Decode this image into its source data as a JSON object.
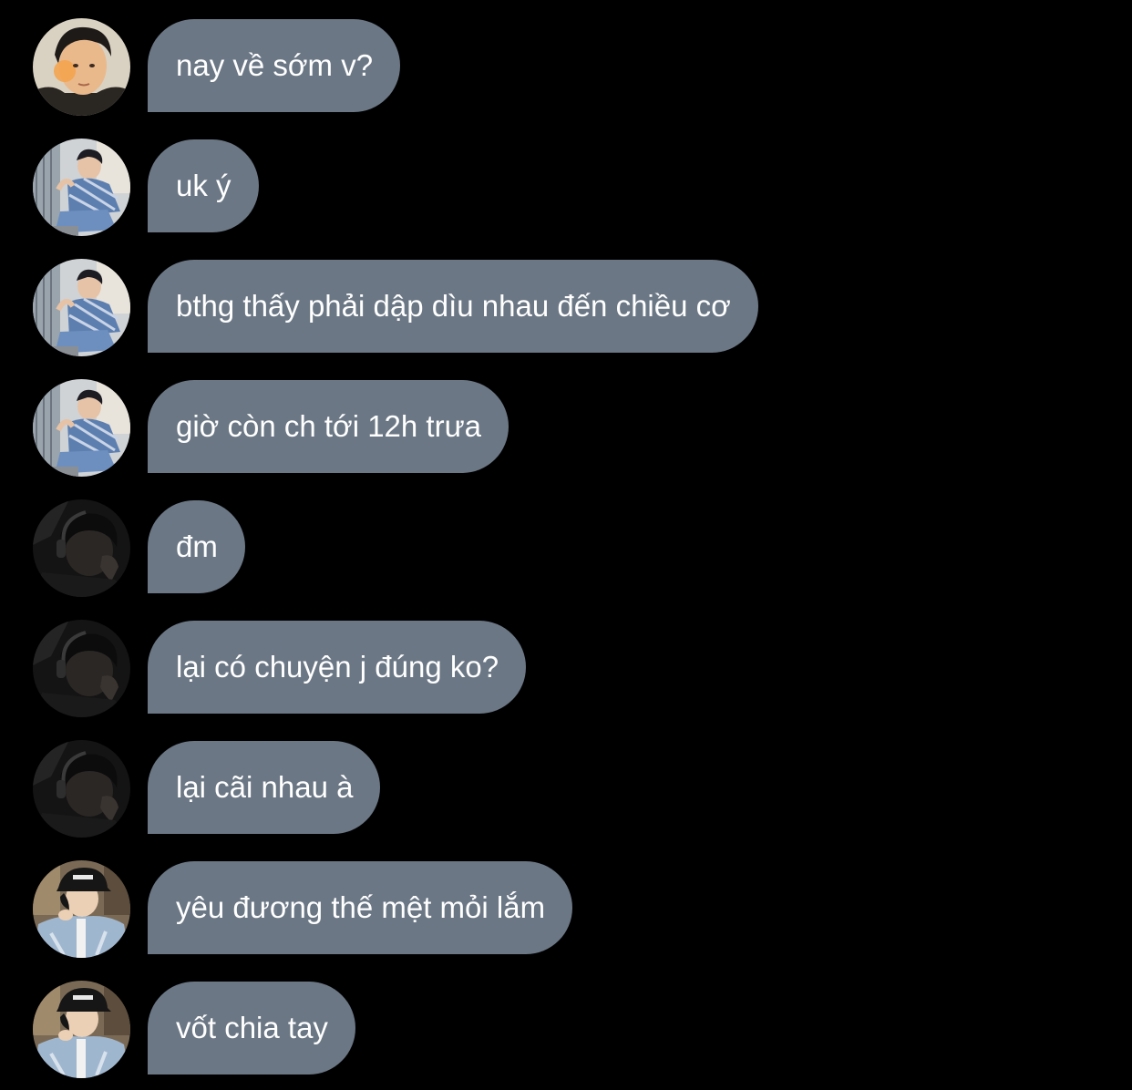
{
  "messages": [
    {
      "avatar": "avatar-a",
      "text": "nay về sớm v?"
    },
    {
      "avatar": "avatar-b",
      "text": "uk ý"
    },
    {
      "avatar": "avatar-b",
      "text": "bthg thấy phải dập dìu nhau đến chiều cơ"
    },
    {
      "avatar": "avatar-b",
      "text": "giờ còn ch tới 12h trưa"
    },
    {
      "avatar": "avatar-c",
      "text": "đm"
    },
    {
      "avatar": "avatar-c",
      "text": "lại có chuyện j đúng ko?"
    },
    {
      "avatar": "avatar-c",
      "text": "lại cãi nhau à"
    },
    {
      "avatar": "avatar-d",
      "text": "yêu đương thế mệt mỏi lắm"
    },
    {
      "avatar": "avatar-d",
      "text": "vốt chia tay"
    }
  ],
  "colors": {
    "background": "#000000",
    "bubble": "#6b7785",
    "text": "#ffffff"
  }
}
